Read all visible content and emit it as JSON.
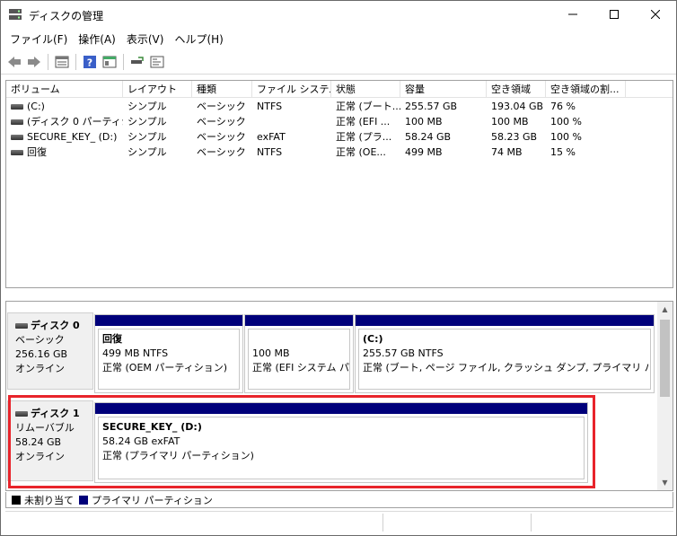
{
  "window": {
    "title": "ディスクの管理"
  },
  "menu": [
    "ファイル(F)",
    "操作(A)",
    "表示(V)",
    "ヘルプ(H)"
  ],
  "toolbar": [
    "back-icon",
    "forward-icon",
    "disk-list-icon",
    "help-icon",
    "properties-icon",
    "rescan-icon",
    "settings-icon"
  ],
  "list": {
    "columns": [
      "ボリューム",
      "レイアウト",
      "種類",
      "ファイル システム",
      "状態",
      "容量",
      "空き領域",
      "空き領域の割..."
    ],
    "rows": [
      [
        "(C:)",
        "シンプル",
        "ベーシック",
        "NTFS",
        "正常 (ブート...",
        "255.57 GB",
        "193.04 GB",
        "76 %"
      ],
      [
        "(ディスク 0 パーティシ...",
        "シンプル",
        "ベーシック",
        "",
        "正常 (EFI ...",
        "100 MB",
        "100 MB",
        "100 %"
      ],
      [
        "SECURE_KEY_ (D:)",
        "シンプル",
        "ベーシック",
        "exFAT",
        "正常 (プラ...",
        "58.24 GB",
        "58.23 GB",
        "100 %"
      ],
      [
        "回復",
        "シンプル",
        "ベーシック",
        "NTFS",
        "正常 (OE...",
        "499 MB",
        "74 MB",
        "15 %"
      ]
    ]
  },
  "disks": [
    {
      "name": "ディスク 0",
      "type": "ベーシック",
      "size": "256.16 GB",
      "status": "オンライン",
      "partitions": [
        {
          "name": "回復",
          "size": "499 MB NTFS",
          "status": "正常 (OEM パーティション)"
        },
        {
          "name": "",
          "size": "100 MB",
          "status": "正常 (EFI システム パー"
        },
        {
          "name": "(C:)",
          "size": "255.57 GB NTFS",
          "status": "正常 (ブート, ページ ファイル, クラッシュ ダンプ, プライマリ パーティション"
        }
      ]
    },
    {
      "name": "ディスク 1",
      "type": "リムーバブル",
      "size": "58.24 GB",
      "status": "オンライン",
      "partitions": [
        {
          "name": "SECURE_KEY_ (D:)",
          "size": "58.24 GB exFAT",
          "status": "正常 (プライマリ パーティション)"
        }
      ]
    }
  ],
  "legend": [
    {
      "label": "未割り当て",
      "color": "#000000"
    },
    {
      "label": "プライマリ パーティション",
      "color": "#00007a"
    }
  ],
  "colors": {
    "partition_bar": "#00007a",
    "highlight": "#e8242b"
  }
}
